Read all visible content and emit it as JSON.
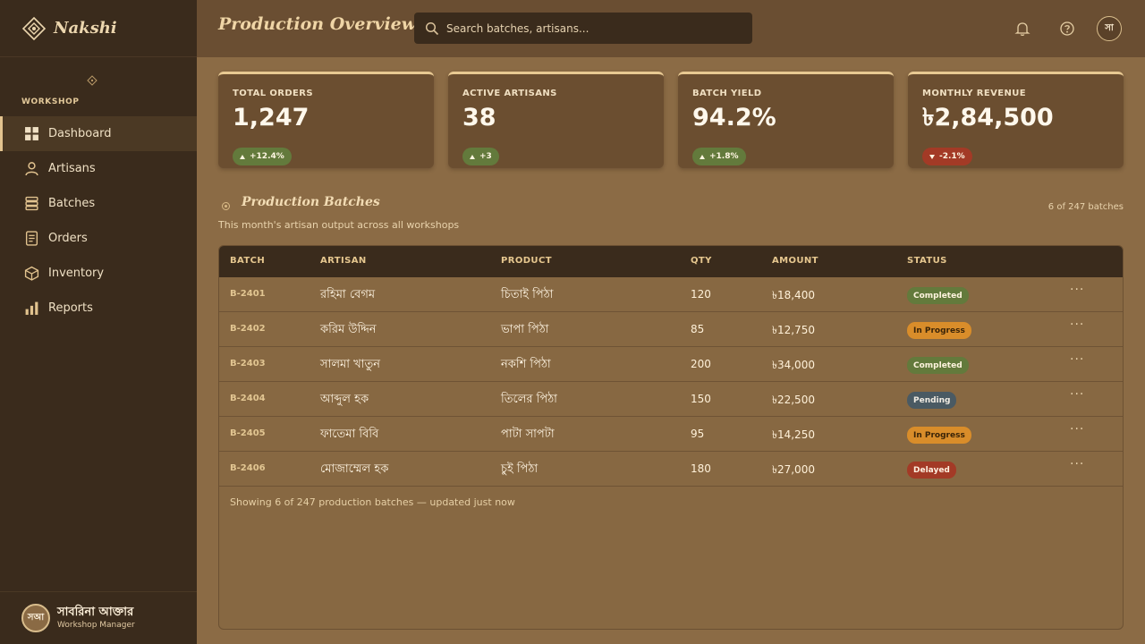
{
  "brand": {
    "name": "Nakshi"
  },
  "sidebar": {
    "section_label": "WORKSHOP",
    "items": [
      {
        "label": "Dashboard",
        "icon": "grid-icon",
        "active": true
      },
      {
        "label": "Artisans",
        "icon": "user-icon",
        "active": false
      },
      {
        "label": "Batches",
        "icon": "stack-icon",
        "active": false
      },
      {
        "label": "Orders",
        "icon": "document-icon",
        "active": false
      },
      {
        "label": "Inventory",
        "icon": "box-icon",
        "active": false
      },
      {
        "label": "Reports",
        "icon": "bar-chart-icon",
        "active": false
      }
    ],
    "user": {
      "initials": "সআ",
      "name": "সাবরিনা আক্তার",
      "role": "Workshop Manager"
    }
  },
  "header": {
    "title": "Production Overview",
    "search_placeholder": "Search batches, artisans...",
    "avatar_initial": "সা"
  },
  "stats": [
    {
      "label": "TOTAL ORDERS",
      "value": "1,247",
      "delta": "+12.4%",
      "trend": "up"
    },
    {
      "label": "ACTIVE ARTISANS",
      "value": "38",
      "delta": "+3",
      "trend": "up"
    },
    {
      "label": "BATCH YIELD",
      "value": "94.2%",
      "delta": "+1.8%",
      "trend": "up"
    },
    {
      "label": "MONTHLY REVENUE",
      "value": "৳2,84,500",
      "delta": "-2.1%",
      "trend": "down"
    }
  ],
  "section": {
    "title": "Production Batches",
    "subtitle": "This month's artisan output across all workshops",
    "count": "6 of 247 batches"
  },
  "table": {
    "headers": [
      "BATCH",
      "ARTISAN",
      "PRODUCT",
      "QTY",
      "AMOUNT",
      "STATUS"
    ],
    "rows": [
      {
        "batch": "B-2401",
        "artisan": "রহিমা বেগম",
        "product": "চিতাই পিঠা",
        "qty": "120",
        "amount": "৳18,400",
        "status": "Completed"
      },
      {
        "batch": "B-2402",
        "artisan": "করিম উদ্দিন",
        "product": "ভাপা পিঠা",
        "qty": "85",
        "amount": "৳12,750",
        "status": "In Progress"
      },
      {
        "batch": "B-2403",
        "artisan": "সালমা খাতুন",
        "product": "নকশি পিঠা",
        "qty": "200",
        "amount": "৳34,000",
        "status": "Completed"
      },
      {
        "batch": "B-2404",
        "artisan": "আব্দুল হক",
        "product": "তিলের পিঠা",
        "qty": "150",
        "amount": "৳22,500",
        "status": "Pending"
      },
      {
        "batch": "B-2405",
        "artisan": "ফাতেমা বিবি",
        "product": "পাটা সাপটা",
        "qty": "95",
        "amount": "৳14,250",
        "status": "In Progress"
      },
      {
        "batch": "B-2406",
        "artisan": "মোজাম্মেল হক",
        "product": "চুই পিঠা",
        "qty": "180",
        "amount": "৳27,000",
        "status": "Delayed"
      }
    ],
    "footer": "Showing 6 of 247 production batches — updated just now",
    "row_action": "···"
  },
  "colors": {
    "sidebar": "#3a2b1c",
    "header": "#6a4e32",
    "background": "#8b6b45",
    "accent": "#e8c992",
    "completed": "#637a3c",
    "in_progress": "#d98d2a",
    "pending": "#4a5a63",
    "delayed": "#a33a26"
  }
}
